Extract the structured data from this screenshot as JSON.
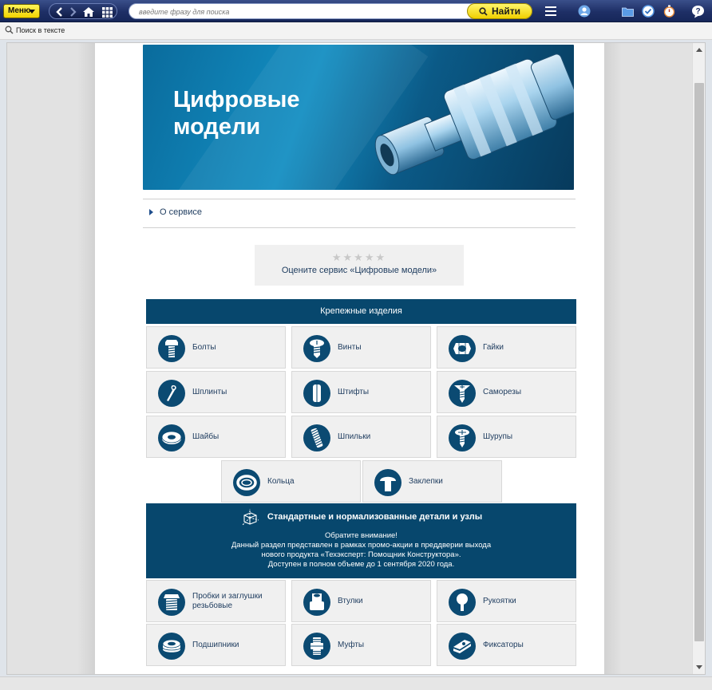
{
  "toolbar": {
    "menu_label": "Меню",
    "search_placeholder": "введите фразу для поиска",
    "find_label": "Найти"
  },
  "subbar": {
    "search_in_text": "Поиск в тексте"
  },
  "banner": {
    "title": "Цифровые\nмодели"
  },
  "about": {
    "label": "О сервисе"
  },
  "rating": {
    "stars": "★★★★★",
    "label": "Оцените сервис «Цифровые модели»"
  },
  "fasteners": {
    "title": "Крепежные изделия",
    "items": [
      {
        "label": "Болты",
        "icon": "bolt-icon"
      },
      {
        "label": "Винты",
        "icon": "screw-icon"
      },
      {
        "label": "Гайки",
        "icon": "nut-icon"
      },
      {
        "label": "Шплинты",
        "icon": "cotter-pin-icon"
      },
      {
        "label": "Штифты",
        "icon": "pin-icon"
      },
      {
        "label": "Саморезы",
        "icon": "self-tapping-screw-icon"
      },
      {
        "label": "Шайбы",
        "icon": "washer-icon"
      },
      {
        "label": "Шпильки",
        "icon": "stud-icon"
      },
      {
        "label": "Шурупы",
        "icon": "wood-screw-icon"
      },
      {
        "label": "Кольца",
        "icon": "ring-icon"
      },
      {
        "label": "Заклепки",
        "icon": "rivet-icon"
      }
    ]
  },
  "standard_parts": {
    "title": "Стандартные и нормализованные детали и узлы",
    "notice": [
      "Обратите внимание!",
      "Данный раздел представлен в рамках промо-акции в преддверии выхода",
      "нового продукта «Техэксперт: Помощник Конструктора».",
      "Доступен в полном объеме до 1 сентября 2020 года."
    ],
    "items": [
      {
        "label": "Пробки и заглушки резьбовые",
        "icon": "threaded-plug-icon"
      },
      {
        "label": "Втулки",
        "icon": "bushing-icon"
      },
      {
        "label": "Рукоятки",
        "icon": "handle-icon"
      },
      {
        "label": "Подшипники",
        "icon": "bearing-icon"
      },
      {
        "label": "Муфты",
        "icon": "coupling-icon"
      },
      {
        "label": "Фиксаторы",
        "icon": "clamp-icon"
      }
    ]
  },
  "colors": {
    "toolbar": "#1e2f66",
    "accent_yellow": "#f2d400",
    "section_header": "#07476d",
    "tile_background": "#f0f0f0",
    "icon_circle": "#0b4a72"
  }
}
